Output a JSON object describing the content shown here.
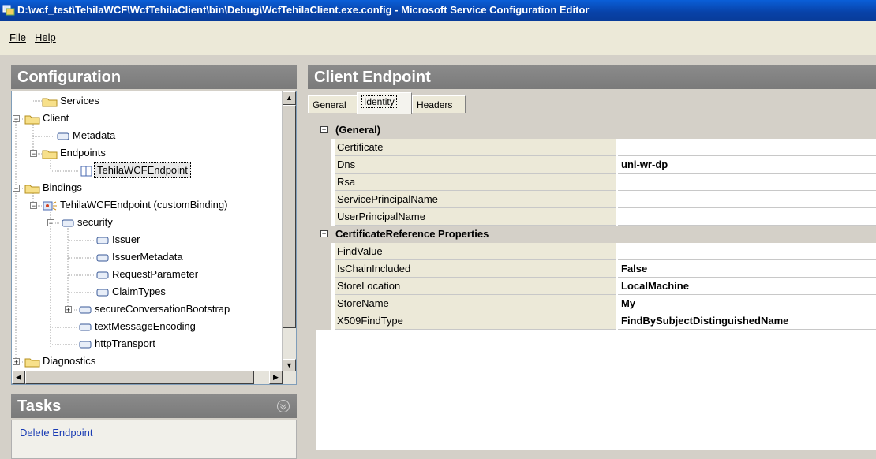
{
  "window": {
    "title": "D:\\wcf_test\\TehilaWCF\\WcfTehilaClient\\bin\\Debug\\WcfTehilaClient.exe.config - Microsoft Service Configuration Editor"
  },
  "menu": {
    "file": "File",
    "help": "Help"
  },
  "config_panel": {
    "title": "Configuration",
    "tree": [
      {
        "label": "Services"
      },
      {
        "label": "Client"
      },
      {
        "label": "Metadata"
      },
      {
        "label": "Endpoints"
      },
      {
        "label": "TehilaWCFEndpoint"
      },
      {
        "label": "Bindings"
      },
      {
        "label": "TehilaWCFEndpoint (customBinding)"
      },
      {
        "label": "security"
      },
      {
        "label": "Issuer"
      },
      {
        "label": "IssuerMetadata"
      },
      {
        "label": "RequestParameter"
      },
      {
        "label": "ClaimTypes"
      },
      {
        "label": "secureConversationBootstrap"
      },
      {
        "label": "textMessageEncoding"
      },
      {
        "label": "httpTransport"
      },
      {
        "label": "Diagnostics"
      }
    ]
  },
  "tasks_panel": {
    "title": "Tasks",
    "delete_endpoint": "Delete Endpoint"
  },
  "endpoint_panel": {
    "title": "Client Endpoint",
    "tabs": [
      {
        "label": "General"
      },
      {
        "label": "Identity"
      },
      {
        "label": "Headers"
      }
    ],
    "categories": [
      {
        "name": "(General)",
        "rows": [
          {
            "name": "Certificate",
            "value": ""
          },
          {
            "name": "Dns",
            "value": "uni-wr-dp"
          },
          {
            "name": "Rsa",
            "value": ""
          },
          {
            "name": "ServicePrincipalName",
            "value": ""
          },
          {
            "name": "UserPrincipalName",
            "value": ""
          }
        ]
      },
      {
        "name": "CertificateReference Properties",
        "rows": [
          {
            "name": "FindValue",
            "value": ""
          },
          {
            "name": "IsChainIncluded",
            "value": "False"
          },
          {
            "name": "StoreLocation",
            "value": "LocalMachine"
          },
          {
            "name": "StoreName",
            "value": "My"
          },
          {
            "name": "X509FindType",
            "value": "FindBySubjectDistinguishedName"
          }
        ]
      }
    ]
  }
}
